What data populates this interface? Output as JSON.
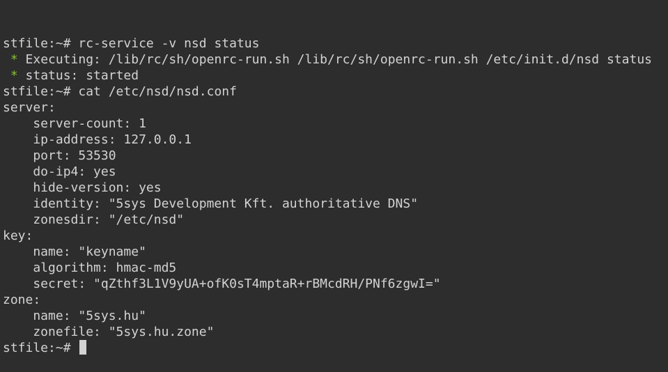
{
  "colors": {
    "background": "#2d2d2d",
    "foreground": "#d3d3d3",
    "star": "#87c236"
  },
  "terminal": {
    "prompt": "stfile:~# ",
    "lines": [
      {
        "kind": "cmd",
        "text": "rc-service -v nsd status"
      },
      {
        "kind": "star",
        "text": " Executing: /lib/rc/sh/openrc-run.sh /lib/rc/sh/openrc-run.sh /etc/init.d/nsd status"
      },
      {
        "kind": "star",
        "text": " status: started"
      },
      {
        "kind": "cmd",
        "text": "cat /etc/nsd/nsd.conf"
      },
      {
        "kind": "out",
        "text": "server:"
      },
      {
        "kind": "out",
        "text": "    server-count: 1"
      },
      {
        "kind": "out",
        "text": "    ip-address: 127.0.0.1"
      },
      {
        "kind": "out",
        "text": "    port: 53530"
      },
      {
        "kind": "out",
        "text": "    do-ip4: yes"
      },
      {
        "kind": "out",
        "text": "    hide-version: yes"
      },
      {
        "kind": "out",
        "text": "    identity: \"5sys Development Kft. authoritative DNS\""
      },
      {
        "kind": "out",
        "text": "    zonesdir: \"/etc/nsd\""
      },
      {
        "kind": "out",
        "text": "key:"
      },
      {
        "kind": "out",
        "text": "    name: \"keyname\""
      },
      {
        "kind": "out",
        "text": "    algorithm: hmac-md5"
      },
      {
        "kind": "out",
        "text": "    secret: \"qZthf3L1V9yUA+ofK0sT4mptaR+rBMcdRH/PNf6zgwI=\""
      },
      {
        "kind": "out",
        "text": "zone:"
      },
      {
        "kind": "out",
        "text": "    name: \"5sys.hu\""
      },
      {
        "kind": "out",
        "text": "    zonefile: \"5sys.hu.zone\""
      },
      {
        "kind": "cursor",
        "text": ""
      }
    ],
    "star_glyph": " *"
  }
}
